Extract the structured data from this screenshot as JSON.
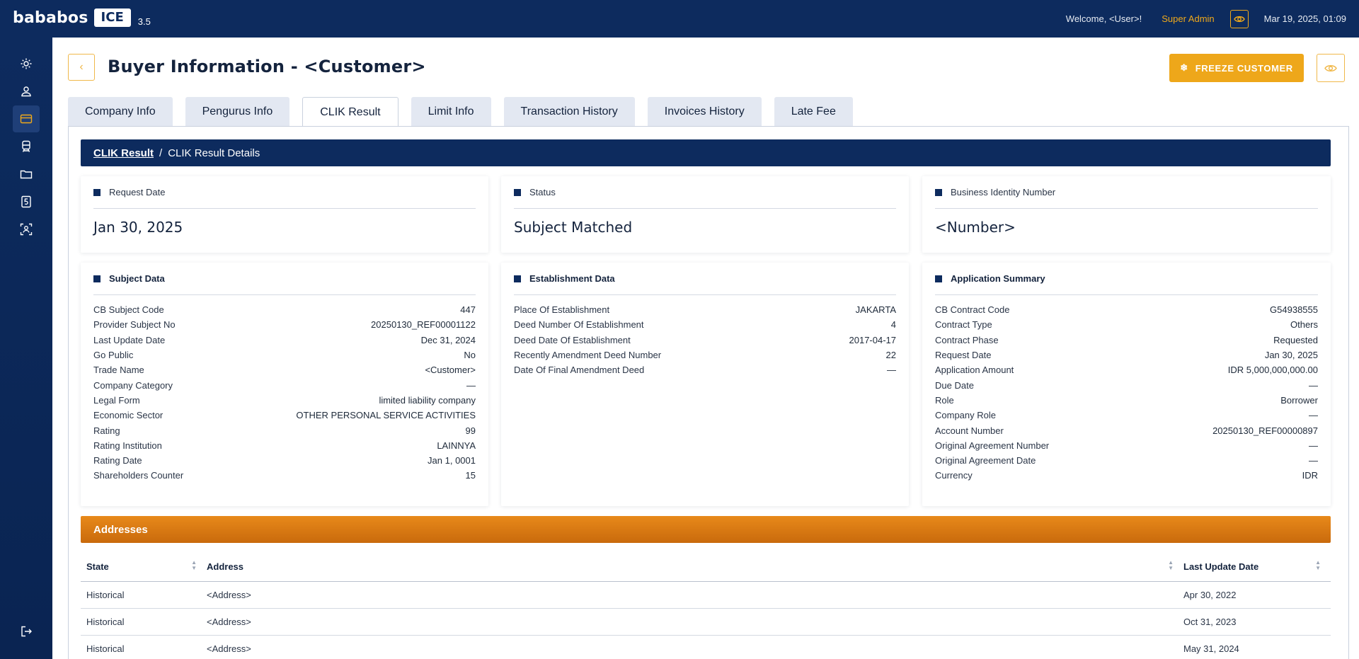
{
  "app": {
    "logo_text": "bababos",
    "logo_badge": "ICE",
    "version": "3.5"
  },
  "topbar": {
    "welcome": "Welcome, <User>!",
    "role": "Super Admin",
    "datetime": "Mar 19, 2025, 01:09"
  },
  "sidebar": {
    "items": [
      "gear-icon",
      "user-icon",
      "card-icon",
      "train-icon",
      "folder-icon",
      "five-icon",
      "face-scan-icon",
      "logout-icon"
    ],
    "active_index": 2
  },
  "page": {
    "title": "Buyer Information - <Customer>",
    "freeze_label": "FREEZE CUSTOMER"
  },
  "tabs": [
    "Company Info",
    "Pengurus Info",
    "CLIK Result",
    "Limit Info",
    "Transaction History",
    "Invoices History",
    "Late Fee"
  ],
  "active_tab": "CLIK Result",
  "breadcrumb": {
    "link": "CLIK Result",
    "sep": "/",
    "current": "CLIK Result Details"
  },
  "summary": {
    "request_date": {
      "label": "Request Date",
      "value": "Jan 30, 2025"
    },
    "status": {
      "label": "Status",
      "value": "Subject Matched"
    },
    "bin": {
      "label": "Business Identity Number",
      "value": "<Number>"
    }
  },
  "subject_data": {
    "title": "Subject Data",
    "rows": [
      {
        "k": "CB Subject Code",
        "v": "447"
      },
      {
        "k": "Provider Subject No",
        "v": "20250130_REF00001122"
      },
      {
        "k": "Last Update Date",
        "v": "Dec 31, 2024"
      },
      {
        "k": "Go Public",
        "v": "No"
      },
      {
        "k": "Trade Name",
        "v": "<Customer>"
      },
      {
        "k": "Company Category",
        "v": "—"
      },
      {
        "k": "Legal Form",
        "v": "limited liability company"
      },
      {
        "k": "Economic Sector",
        "v": "OTHER PERSONAL SERVICE ACTIVITIES"
      },
      {
        "k": "Rating",
        "v": "99"
      },
      {
        "k": "Rating Institution",
        "v": "LAINNYA"
      },
      {
        "k": "Rating Date",
        "v": "Jan 1, 0001"
      },
      {
        "k": "Shareholders Counter",
        "v": "15"
      }
    ]
  },
  "establishment_data": {
    "title": "Establishment Data",
    "rows": [
      {
        "k": "Place Of Establishment",
        "v": "JAKARTA"
      },
      {
        "k": "Deed Number Of Establishment",
        "v": "4"
      },
      {
        "k": "Deed Date Of Establishment",
        "v": "2017-04-17"
      },
      {
        "k": "Recently Amendment Deed Number",
        "v": "22"
      },
      {
        "k": "Date Of Final Amendment Deed",
        "v": "—"
      }
    ]
  },
  "application_summary": {
    "title": "Application Summary",
    "rows": [
      {
        "k": "CB Contract Code",
        "v": "G54938555"
      },
      {
        "k": "Contract Type",
        "v": "Others"
      },
      {
        "k": "Contract Phase",
        "v": "Requested"
      },
      {
        "k": "Request Date",
        "v": "Jan 30, 2025"
      },
      {
        "k": "Application Amount",
        "v": "IDR 5,000,000,000.00"
      },
      {
        "k": "Due Date",
        "v": "—"
      },
      {
        "k": "Role",
        "v": "Borrower"
      },
      {
        "k": "Company Role",
        "v": "—"
      },
      {
        "k": "Account Number",
        "v": "20250130_REF00000897"
      },
      {
        "k": "Original Agreement Number",
        "v": "—"
      },
      {
        "k": "Original Agreement Date",
        "v": "—"
      },
      {
        "k": "Currency",
        "v": "IDR"
      }
    ]
  },
  "addresses": {
    "title": "Addresses",
    "columns": [
      "State",
      "Address",
      "Last Update Date"
    ],
    "rows": [
      [
        "Historical",
        "<Address>",
        "Apr 30, 2022"
      ],
      [
        "Historical",
        "<Address>",
        "Oct 31, 2023"
      ],
      [
        "Historical",
        "<Address>",
        "May 31, 2024"
      ]
    ]
  },
  "colors": {
    "navy": "#0d2b5e",
    "accent": "#eea71a",
    "orange": "#e8891a"
  }
}
